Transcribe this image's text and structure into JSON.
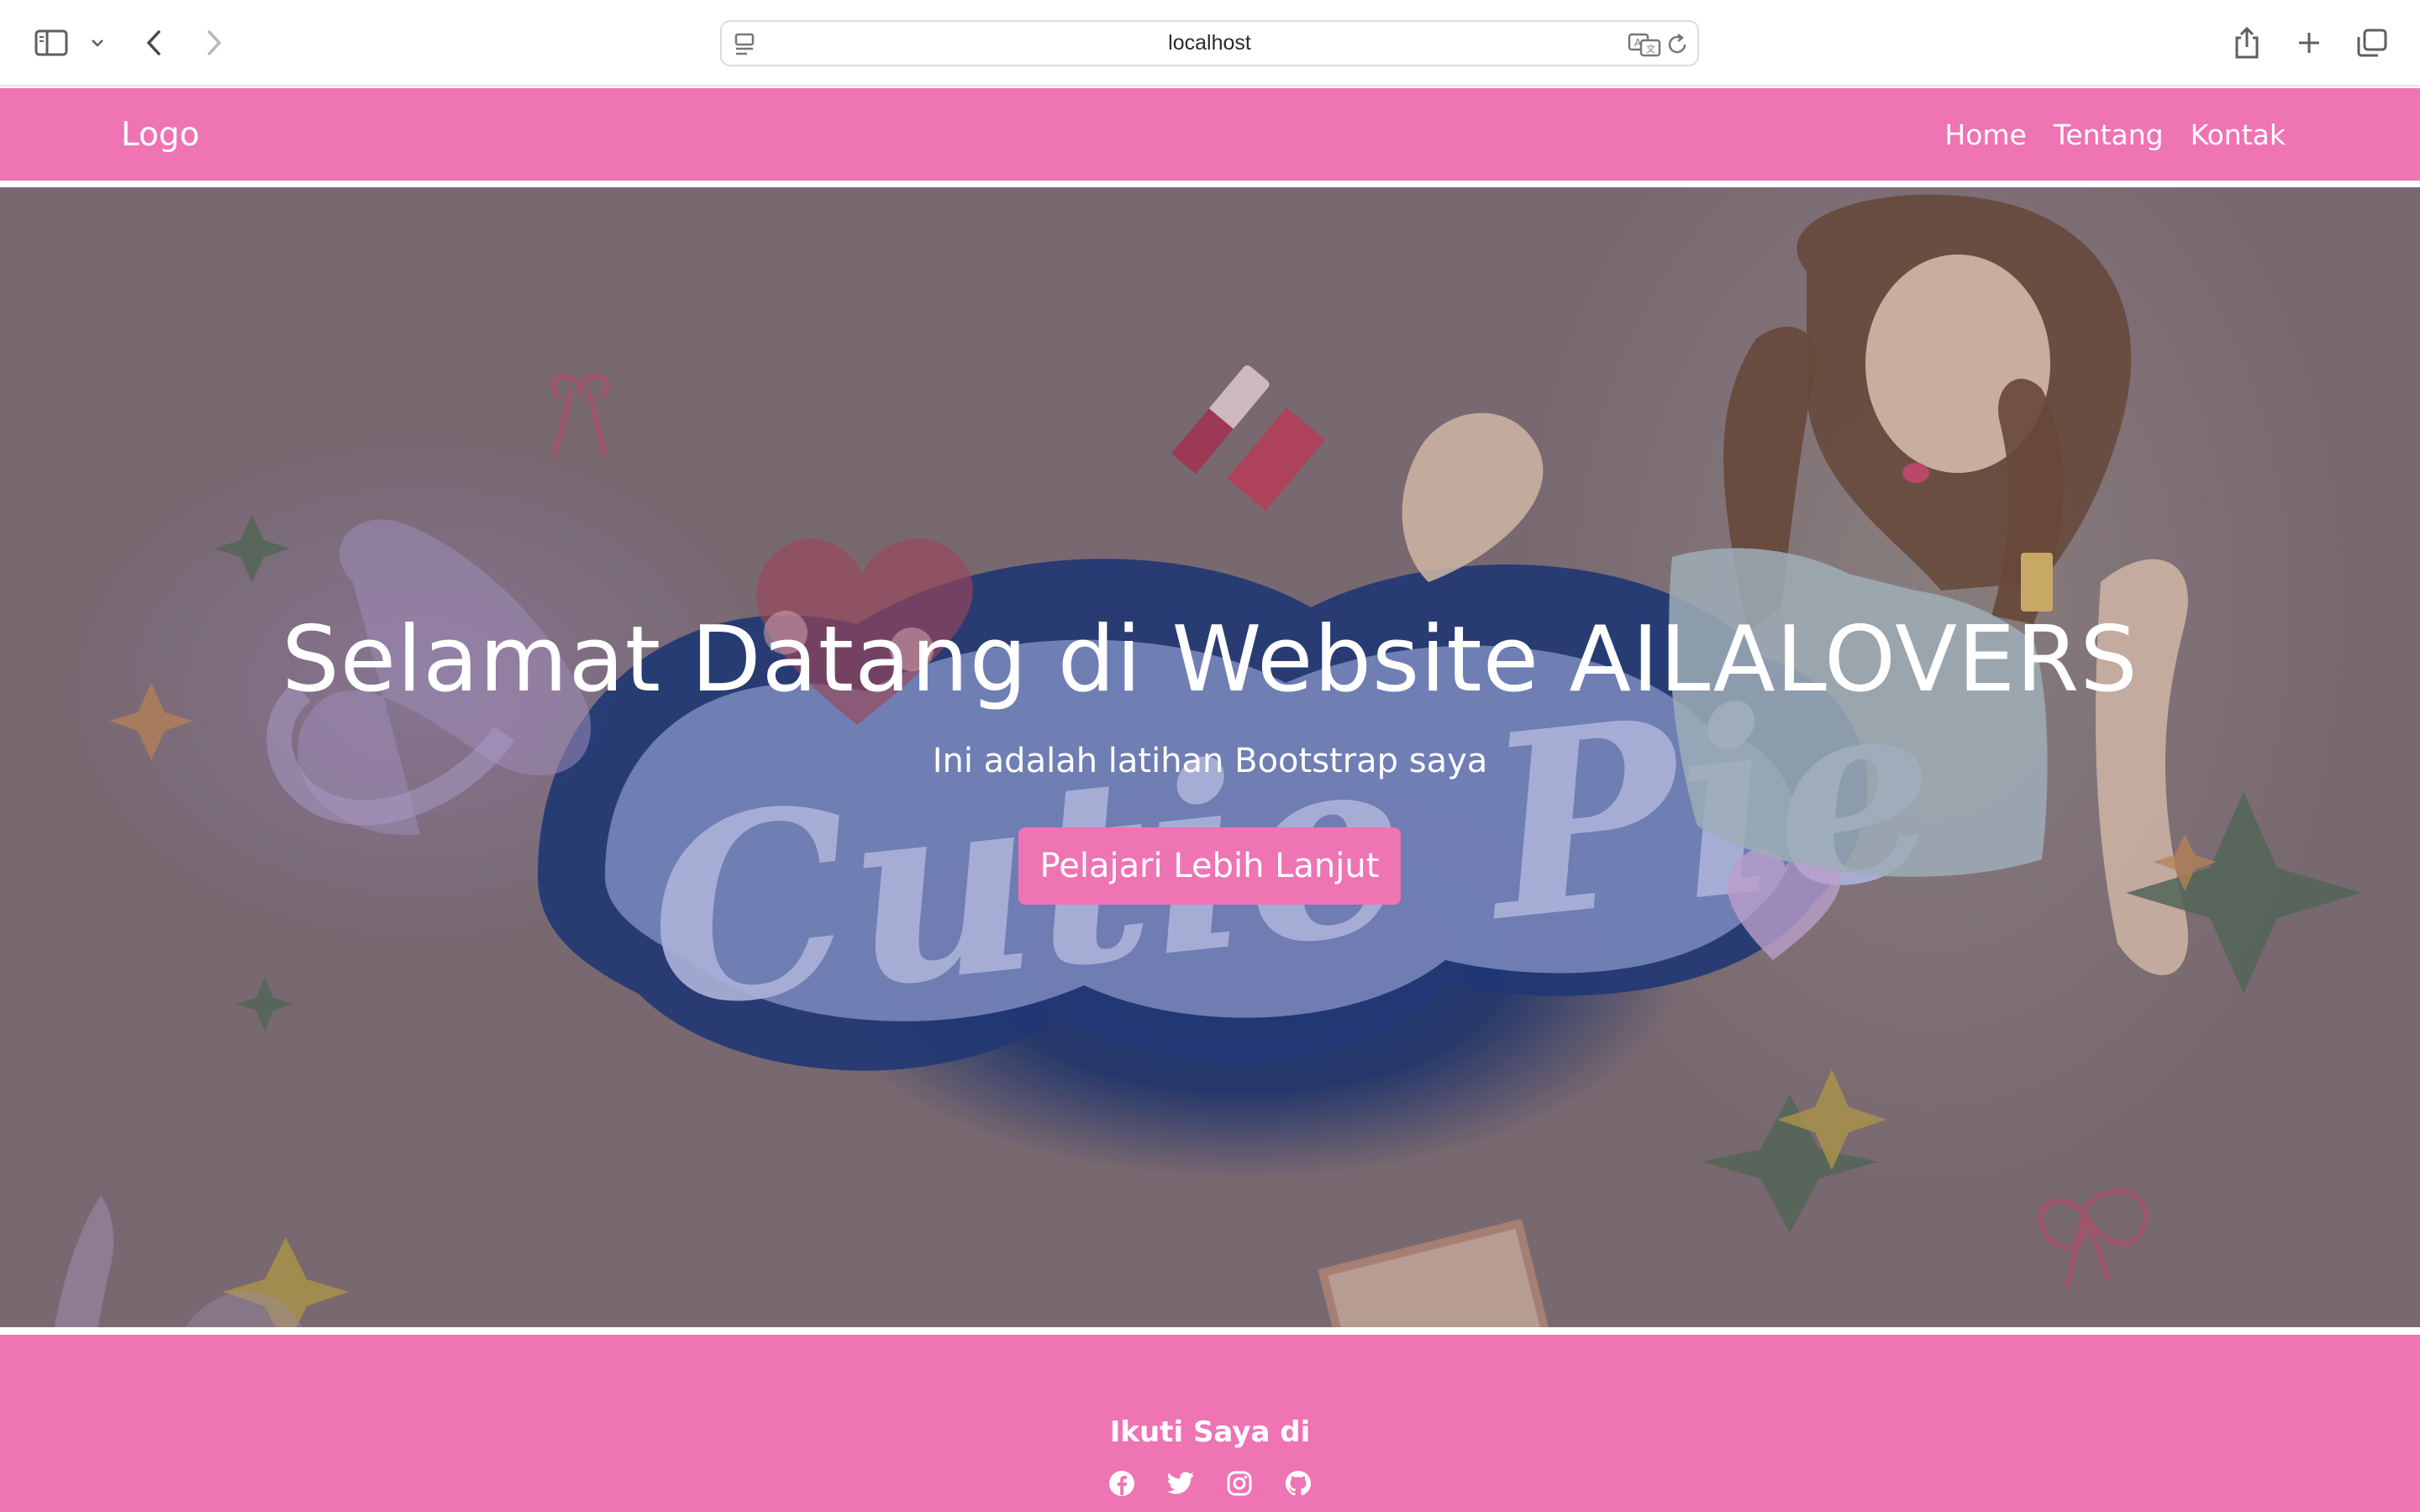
{
  "browser": {
    "url": "localhost"
  },
  "navbar": {
    "logo": "Logo",
    "links": [
      "Home",
      "Tentang",
      "Kontak"
    ]
  },
  "hero": {
    "title": "Selamat Datang di Website AILALOVERS",
    "subtitle": "Ini adalah latihan Bootstrap saya",
    "button_label": "Pelajari Lebih Lanjut",
    "background_text": "Cutie Pie"
  },
  "footer": {
    "heading": "Ikuti Saya di",
    "social_icons": [
      "facebook-icon",
      "twitter-icon",
      "instagram-icon",
      "github-icon"
    ]
  },
  "colors": {
    "accent_pink": "#ee74b4",
    "hero_tint": "#7d6e76",
    "text_white": "#ffffff"
  }
}
